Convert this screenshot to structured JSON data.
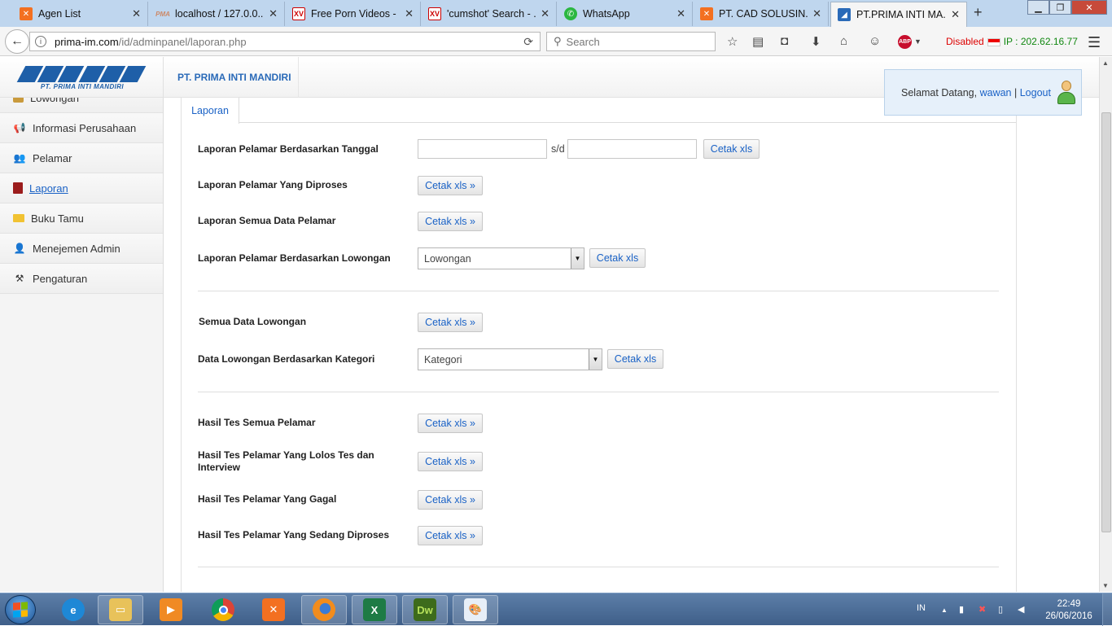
{
  "browser": {
    "tabs": [
      {
        "title": "Agen List",
        "icon": "xampp-icon",
        "fav": "fav-x",
        "glyph": "✕"
      },
      {
        "title": "localhost / 127.0.0....",
        "icon": "phpmyadmin-icon",
        "fav": "fav-pma",
        "glyph": "PMA"
      },
      {
        "title": "Free Porn Videos - ...",
        "icon": "xvideos-icon",
        "fav": "fav-xv",
        "glyph": "XV"
      },
      {
        "title": "'cumshot' Search - ...",
        "icon": "xvideos-icon",
        "fav": "fav-xv",
        "glyph": "XV"
      },
      {
        "title": "WhatsApp",
        "icon": "whatsapp-icon",
        "fav": "fav-wa",
        "glyph": "✆"
      },
      {
        "title": "PT. CAD SOLUSIN...",
        "icon": "xampp-icon",
        "fav": "fav-x",
        "glyph": "✕"
      },
      {
        "title": "PT.PRIMA INTI MA...",
        "icon": "prima-icon",
        "fav": "fav-pim",
        "glyph": "◢"
      }
    ],
    "url_host": "prima-im.com",
    "url_path": "/id/adminpanel/laporan.php",
    "search_placeholder": "Search",
    "status_disabled": "Disabled",
    "ip_label": "IP : 202.62.16.77"
  },
  "header": {
    "logo_text": "PT. PRIMA INTI MANDIRI",
    "brand_link": "PT. PRIMA INTI MANDIRI",
    "welcome_prefix": "Selamat Datang,",
    "username": "wawan",
    "separator": "|",
    "logout": "Logout"
  },
  "sidebar": {
    "items": [
      {
        "label": "Lowongan",
        "name": "sidebar-item-lowongan",
        "icon": "briefcase-icon"
      },
      {
        "label": "Informasi Perusahaan",
        "name": "sidebar-item-informasi-perusahaan",
        "icon": "megaphone-icon"
      },
      {
        "label": "Pelamar",
        "name": "sidebar-item-pelamar",
        "icon": "users-icon"
      },
      {
        "label": "Laporan",
        "name": "sidebar-item-laporan",
        "icon": "book-icon",
        "active": true
      },
      {
        "label": "Buku Tamu",
        "name": "sidebar-item-buku-tamu",
        "icon": "envelope-icon"
      },
      {
        "label": "Menejemen Admin",
        "name": "sidebar-item-menejemen-admin",
        "icon": "admin-icon"
      },
      {
        "label": "Pengaturan",
        "name": "sidebar-item-pengaturan",
        "icon": "tools-icon"
      }
    ]
  },
  "main": {
    "tab_label": "Laporan",
    "sd_label": "s/d",
    "btn_cetak": "Cetak xls",
    "btn_cetak_more": "Cetak xls »",
    "rows": {
      "r1": "Laporan Pelamar Berdasarkan Tanggal",
      "r2": "Laporan Pelamar Yang Diproses",
      "r3": "Laporan Semua Data Pelamar",
      "r4": "Laporan Pelamar Berdasarkan Lowongan",
      "r5": "Semua Data Lowongan",
      "r6": "Data Lowongan Berdasarkan Kategori",
      "r7": "Hasil Tes Semua Pelamar",
      "r8": "Hasil Tes Pelamar Yang Lolos Tes dan Interview",
      "r9": "Hasil Tes Pelamar Yang Gagal",
      "r10": "Hasil Tes Pelamar Yang Sedang Diproses"
    },
    "select_lowongan": "Lowongan",
    "select_kategori": "Kategori"
  },
  "taskbar": {
    "lang": "IN",
    "time": "22:49",
    "date": "26/06/2016"
  },
  "colors": {
    "accent": "#1a62c6",
    "brand": "#1e5fa8",
    "ip_green": "#118811",
    "disabled_red": "#dd0000"
  }
}
